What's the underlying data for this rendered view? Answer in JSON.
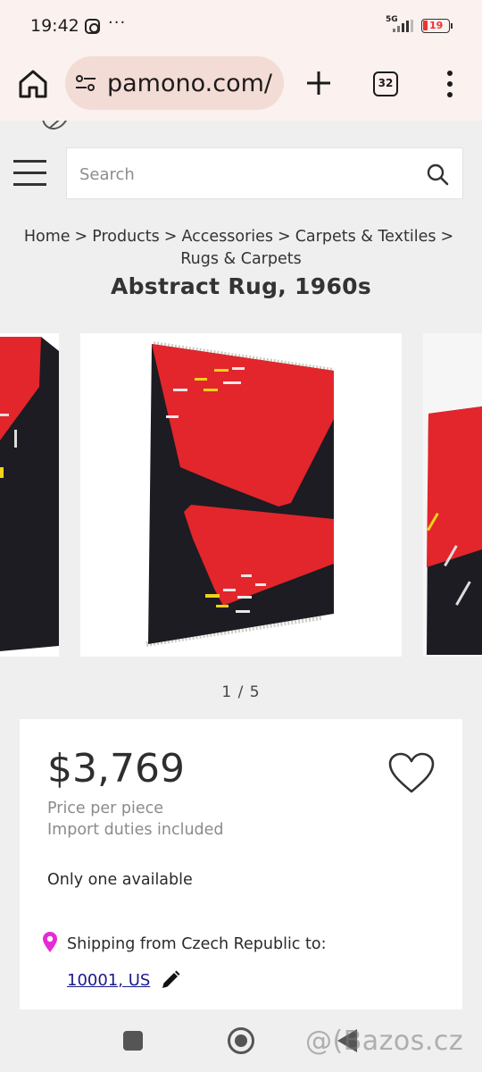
{
  "status_bar": {
    "time": "19:42",
    "overflow": "···",
    "network": "5G",
    "battery": "19"
  },
  "browser": {
    "url": "pamono.com/",
    "tab_count": "32",
    "icons": [
      "home-icon",
      "site-settings-icon",
      "new-tab-icon",
      "tabs-icon",
      "overflow-menu-icon"
    ]
  },
  "header": {
    "search_placeholder": "Search"
  },
  "breadcrumb": {
    "items": [
      "Home",
      "Products",
      "Accessories",
      "Carpets & Textiles",
      "Rugs & Carpets"
    ],
    "separator": ">"
  },
  "product": {
    "title": "Abstract Rug, 1960s",
    "image_counter": "1 / 5",
    "price": "$3,769",
    "price_note": "Price per piece",
    "duties_note": "Import duties included",
    "availability": "Only one available",
    "shipping_label": "Shipping from Czech Republic to:",
    "shipping_destination": "10001, US"
  },
  "colors": {
    "rug_red": "#e2262b",
    "rug_black": "#1c1c22",
    "pin_magenta": "#e62ad5",
    "link_blue": "#1a1a8c"
  },
  "watermark": "@(Bazos.cz"
}
